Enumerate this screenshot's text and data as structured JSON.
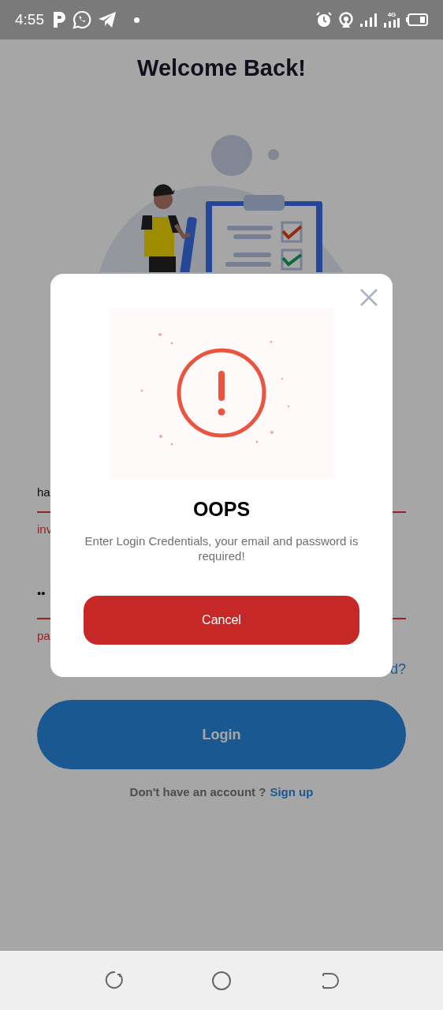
{
  "status_bar": {
    "time": "4:55",
    "network": "4G"
  },
  "page": {
    "title": "Welcome Back!",
    "email_field": {
      "value": "ha",
      "error": "inv"
    },
    "password_field": {
      "value": "••",
      "error": "pa"
    },
    "forgot_password_link": "d?",
    "login_button": "Login",
    "signup_prompt": {
      "text": "Don't have an account ?",
      "link": "Sign up"
    }
  },
  "dialog": {
    "title": "OOPS",
    "message": "Enter Login Credentials, your email and password is required!",
    "cancel_button": "Cancel"
  }
}
